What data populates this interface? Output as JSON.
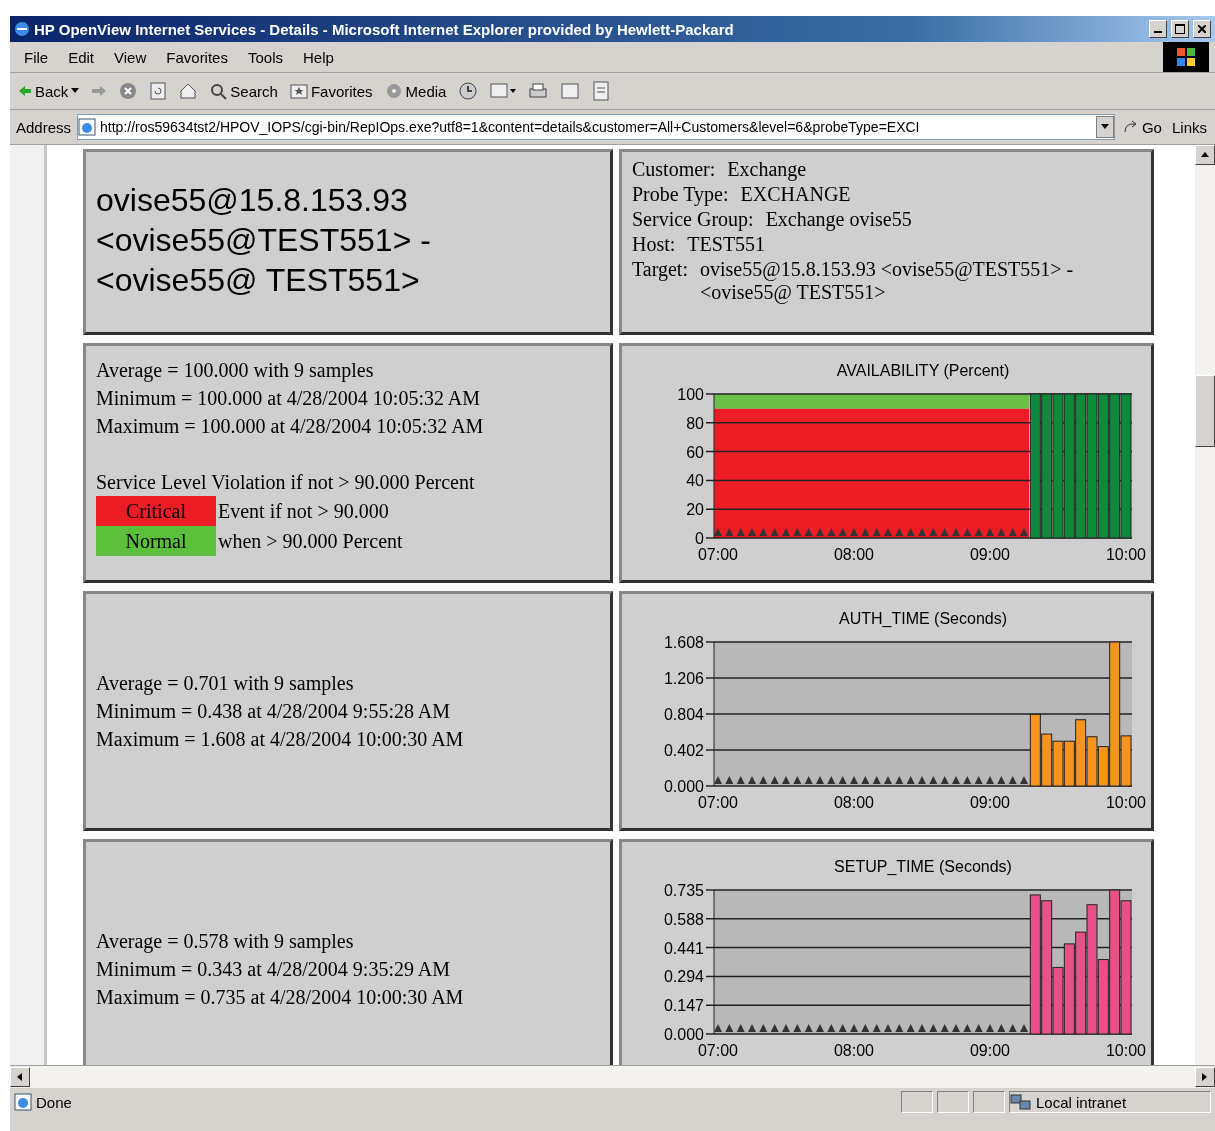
{
  "window": {
    "title": "HP OpenView Internet Services - Details - Microsoft Internet Explorer provided by Hewlett-Packard"
  },
  "menu": [
    {
      "label": "File"
    },
    {
      "label": "Edit"
    },
    {
      "label": "View"
    },
    {
      "label": "Favorites"
    },
    {
      "label": "Tools"
    },
    {
      "label": "Help"
    }
  ],
  "toolbar": {
    "back": "Back",
    "search": "Search",
    "favorites": "Favorites",
    "media": "Media"
  },
  "address": {
    "label": "Address",
    "value": "http://ros59634tst2/HPOV_IOPS/cgi-bin/RepIOps.exe?utf8=1&content=details&customer=All+Customers&level=6&probeType=EXCI",
    "go": "Go",
    "links": "Links"
  },
  "header": {
    "title_lines": [
      "ovise55@15.8.153.93",
      "<ovise55@TEST551> -",
      "<ovise55@ TEST551>"
    ],
    "info": [
      {
        "label": "Customer:",
        "value": "Exchange"
      },
      {
        "label": "Probe Type:",
        "value": "EXCHANGE"
      },
      {
        "label": "Service Group:",
        "value": "Exchange ovise55"
      },
      {
        "label": "Host:",
        "value": "TEST551"
      },
      {
        "label": "Target:",
        "value": "ovise55@15.8.153.93 <ovise55@TEST551> - <ovise55@ TEST551>"
      }
    ]
  },
  "metrics": [
    {
      "stats": [
        "Average = 100.000 with 9 samples",
        "Minimum = 100.000 at 4/28/2004 10:05:32 AM",
        "Maximum = 100.000 at 4/28/2004 10:05:32 AM"
      ],
      "violation": "Service Level Violation if not > 90.000 Percent",
      "legend": [
        {
          "label": "Critical",
          "text": "Event if not > 90.000",
          "color": "#ee1c24"
        },
        {
          "label": "Normal",
          "text": "when > 90.000 Percent",
          "color": "#5cbf3c"
        }
      ],
      "chart_data": {
        "type": "bar",
        "title": "AVAILABILITY (Percent)",
        "ylim": [
          0,
          100
        ],
        "categories": [
          "07:00",
          null,
          null,
          null,
          null,
          null,
          null,
          null,
          null,
          null,
          null,
          null,
          "08:00",
          null,
          null,
          null,
          null,
          null,
          null,
          null,
          null,
          null,
          null,
          null,
          "09:00",
          null,
          null,
          null,
          null,
          null,
          null,
          null,
          null,
          null,
          null,
          null,
          "10:00"
        ],
        "yticks": [
          0,
          20,
          40,
          60,
          80,
          100
        ],
        "grid": true,
        "series": [
          {
            "color": "#0f8a3a",
            "values": [
              null,
              null,
              null,
              null,
              null,
              null,
              null,
              null,
              null,
              null,
              null,
              null,
              null,
              null,
              null,
              null,
              null,
              null,
              null,
              null,
              null,
              null,
              null,
              null,
              null,
              null,
              null,
              null,
              100,
              100,
              100,
              100,
              100,
              100,
              100,
              100,
              100
            ]
          }
        ]
      }
    },
    {
      "stats": [
        "Average = 0.701 with 9 samples",
        "Minimum = 0.438 at 4/28/2004 9:55:28 AM",
        "Maximum = 1.608 at 4/28/2004 10:00:30 AM"
      ],
      "chart_data": {
        "type": "bar",
        "title": "AUTH_TIME (Seconds)",
        "ylim": [
          0,
          1.608
        ],
        "categories": [
          "07:00",
          null,
          null,
          null,
          null,
          null,
          null,
          null,
          null,
          null,
          null,
          null,
          "08:00",
          null,
          null,
          null,
          null,
          null,
          null,
          null,
          null,
          null,
          null,
          null,
          "09:00",
          null,
          null,
          null,
          null,
          null,
          null,
          null,
          null,
          null,
          null,
          null,
          "10:00"
        ],
        "yticks": [
          {
            "value": 0,
            "label": "0.000"
          },
          {
            "value": 0.402,
            "label": "0.402"
          },
          {
            "value": 0.804,
            "label": "0.804"
          },
          {
            "value": 1.206,
            "label": "1.206"
          },
          {
            "value": 1.608,
            "label": "1.608"
          }
        ],
        "grid": true,
        "series": [
          {
            "color": "#f7941d",
            "values": [
              null,
              null,
              null,
              null,
              null,
              null,
              null,
              null,
              null,
              null,
              null,
              null,
              null,
              null,
              null,
              null,
              null,
              null,
              null,
              null,
              null,
              null,
              null,
              null,
              null,
              null,
              null,
              null,
              0.8,
              0.58,
              0.5,
              0.5,
              0.74,
              0.55,
              0.44,
              1.608,
              0.56
            ]
          }
        ]
      }
    },
    {
      "stats": [
        "Average = 0.578 with 9 samples",
        "Minimum = 0.343 at 4/28/2004 9:35:29 AM",
        "Maximum = 0.735 at 4/28/2004 10:00:30 AM"
      ],
      "chart_data": {
        "type": "bar",
        "title": "SETUP_TIME (Seconds)",
        "ylim": [
          0,
          0.735
        ],
        "categories": [
          "07:00",
          null,
          null,
          null,
          null,
          null,
          null,
          null,
          null,
          null,
          null,
          null,
          "08:00",
          null,
          null,
          null,
          null,
          null,
          null,
          null,
          null,
          null,
          null,
          null,
          "09:00",
          null,
          null,
          null,
          null,
          null,
          null,
          null,
          null,
          null,
          null,
          null,
          "10:00"
        ],
        "yticks": [
          {
            "value": 0,
            "label": "0.000"
          },
          {
            "value": 0.147,
            "label": "0.147"
          },
          {
            "value": 0.294,
            "label": "0.294"
          },
          {
            "value": 0.441,
            "label": "0.441"
          },
          {
            "value": 0.588,
            "label": "0.588"
          },
          {
            "value": 0.735,
            "label": "0.735"
          }
        ],
        "grid": true,
        "series": [
          {
            "color": "#e8508a",
            "values": [
              null,
              null,
              null,
              null,
              null,
              null,
              null,
              null,
              null,
              null,
              null,
              null,
              null,
              null,
              null,
              null,
              null,
              null,
              null,
              null,
              null,
              null,
              null,
              null,
              null,
              null,
              null,
              null,
              0.71,
              0.68,
              0.34,
              0.46,
              0.52,
              0.66,
              0.38,
              0.735,
              0.68
            ]
          }
        ]
      }
    }
  ],
  "status": {
    "text": "Done",
    "zone": "Local intranet"
  }
}
